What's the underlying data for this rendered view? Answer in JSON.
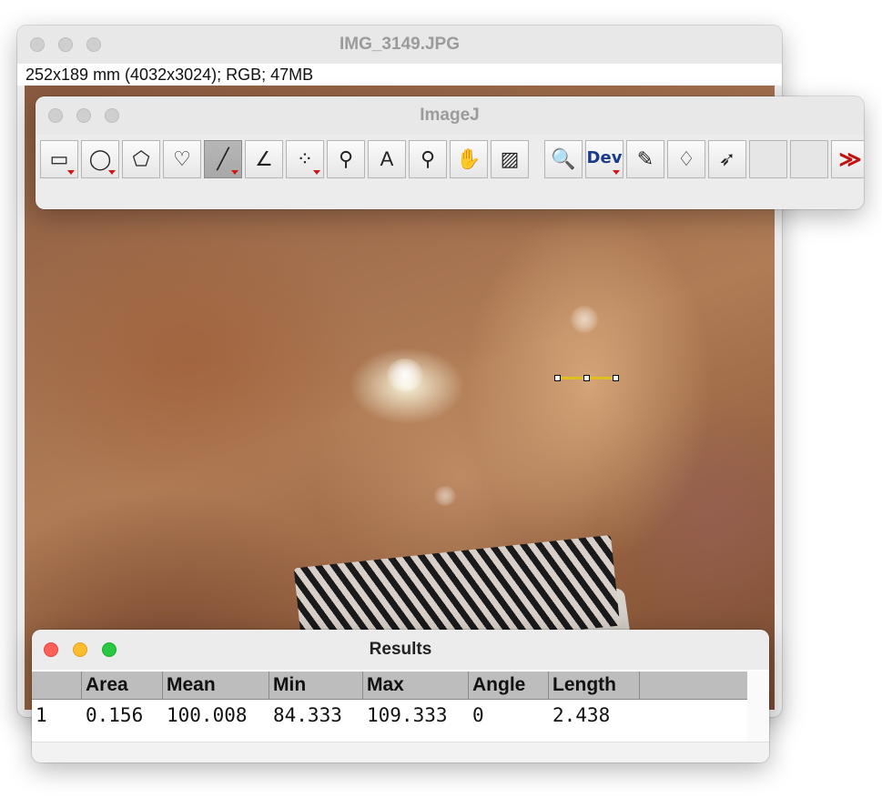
{
  "image_window": {
    "title": "IMG_3149.JPG",
    "info": "252x189 mm (4032x3024); RGB; 47MB"
  },
  "toolbar_window": {
    "title": "ImageJ",
    "tools": [
      {
        "icon": "rectangle-tool-icon",
        "glyph": "▭",
        "has_menu": true
      },
      {
        "icon": "oval-tool-icon",
        "glyph": "◯",
        "has_menu": true
      },
      {
        "icon": "polygon-tool-icon",
        "glyph": "⬠",
        "has_menu": false
      },
      {
        "icon": "freehand-tool-icon",
        "glyph": "♡",
        "has_menu": false
      },
      {
        "icon": "line-tool-icon",
        "glyph": "╱",
        "has_menu": true,
        "active": true
      },
      {
        "icon": "angle-tool-icon",
        "glyph": "∠",
        "has_menu": false
      },
      {
        "icon": "multipoint-tool-icon",
        "glyph": "⁘",
        "has_menu": true
      },
      {
        "icon": "wand-tool-icon",
        "glyph": "⚲",
        "has_menu": false
      },
      {
        "icon": "text-tool-icon",
        "glyph": "A",
        "has_menu": false
      },
      {
        "icon": "magnifier-tool-icon",
        "glyph": "⚲",
        "has_menu": false
      },
      {
        "icon": "hand-tool-icon",
        "glyph": "✋",
        "has_menu": false
      },
      {
        "icon": "color-picker-tool-icon",
        "glyph": "▨",
        "has_menu": false
      },
      {
        "icon": "zoom-tool-icon",
        "glyph": "🔍",
        "has_menu": false
      },
      {
        "icon": "dev-menu-icon",
        "label": "Dev",
        "has_menu": true
      },
      {
        "icon": "brush-tool-icon",
        "glyph": "✎",
        "has_menu": false
      },
      {
        "icon": "flood-fill-tool-icon",
        "glyph": "♢",
        "has_menu": false
      },
      {
        "icon": "arrow-tool-icon",
        "glyph": "➶",
        "has_menu": false
      },
      {
        "icon": "empty-slot-icon",
        "glyph": "",
        "has_menu": false
      },
      {
        "icon": "empty-slot-icon",
        "glyph": "",
        "has_menu": false
      },
      {
        "icon": "more-tools-icon",
        "glyph": "≫",
        "has_menu": false
      }
    ]
  },
  "results_window": {
    "title": "Results",
    "columns": [
      "",
      "Area",
      "Mean",
      "Min",
      "Max",
      "Angle",
      "Length"
    ],
    "rows": [
      [
        "1",
        "0.156",
        "100.008",
        "84.333",
        "109.333",
        "0",
        "2.438"
      ]
    ]
  },
  "colors": {
    "selection_line": "#e0c020",
    "close": "#fe5f57",
    "minimize": "#febc2e",
    "zoom": "#28c840",
    "active_arrow": "#d01818"
  }
}
